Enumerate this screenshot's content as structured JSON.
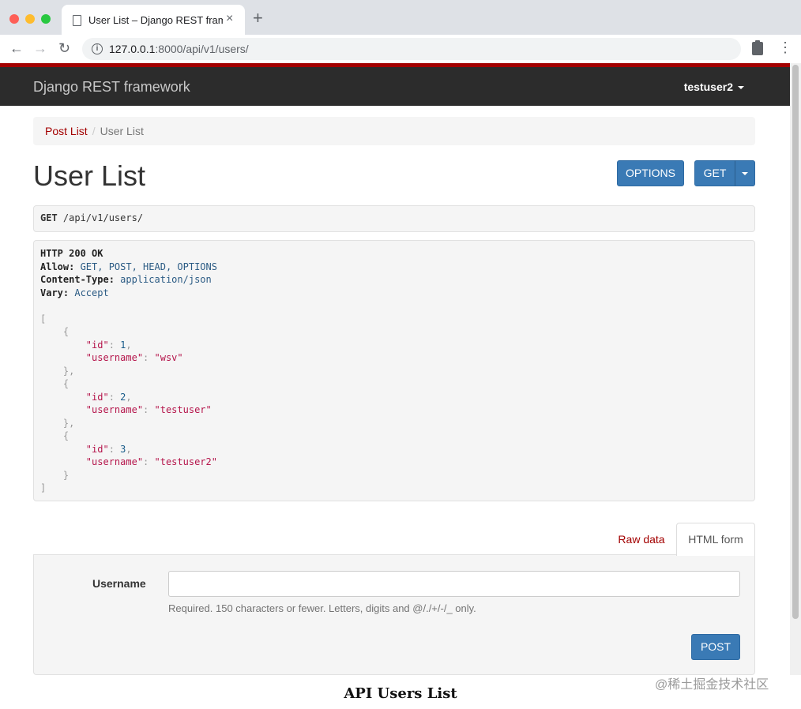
{
  "browser": {
    "tab_title": "User List – Django REST framework",
    "tab_close": "×",
    "new_tab": "+",
    "url_host": "127.0.0.1",
    "url_path": ":8000/api/v1/users/"
  },
  "navbar": {
    "brand": "Django REST framework",
    "user": "testuser2"
  },
  "breadcrumb": {
    "items": [
      "Post List",
      "User List"
    ],
    "separator": "/"
  },
  "page": {
    "title": "User List"
  },
  "buttons": {
    "options": "OPTIONS",
    "get": "GET",
    "post": "POST"
  },
  "request": {
    "method": "GET",
    "path": " /api/v1/users/"
  },
  "response": {
    "status": "HTTP 200 OK",
    "headers": [
      {
        "key": "Allow:",
        "value": " GET, POST, HEAD, OPTIONS"
      },
      {
        "key": "Content-Type:",
        "value": " application/json"
      },
      {
        "key": "Vary:",
        "value": " Accept"
      }
    ],
    "users": [
      {
        "id": "1",
        "username": "\"wsv\""
      },
      {
        "id": "2",
        "username": "\"testuser\""
      },
      {
        "id": "3",
        "username": "\"testuser2\""
      }
    ]
  },
  "form_tabs": {
    "raw": "Raw data",
    "html": "HTML form"
  },
  "form": {
    "username_label": "Username",
    "username_value": "",
    "help_text": "Required. 150 characters or fewer. Letters, digits and @/./+/-/_ only."
  },
  "caption": "API Users List",
  "watermark": "@稀土掘金技术社区",
  "colors": {
    "navbar_bg": "#2c2c2c",
    "navbar_accent": "#a30000",
    "button_blue": "#3a7ab5"
  }
}
